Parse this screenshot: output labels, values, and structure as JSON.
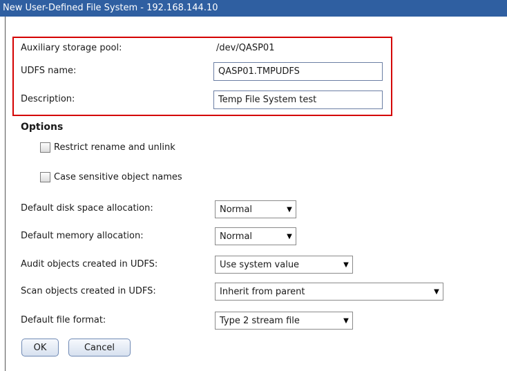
{
  "window": {
    "title": "New User-Defined File System - 192.168.144.10"
  },
  "form": {
    "asp": {
      "label": "Auxiliary storage pool:",
      "value": "/dev/QASP01"
    },
    "udfs_name": {
      "label": "UDFS name:",
      "value": "QASP01.TMPUDFS"
    },
    "description": {
      "label": "Description:",
      "value": "Temp File System test"
    }
  },
  "options": {
    "title": "Options",
    "restrict_rename": {
      "label": "Restrict rename and unlink",
      "checked": false
    },
    "case_sensitive": {
      "label": "Case sensitive object names",
      "checked": false
    }
  },
  "settings": {
    "disk_space": {
      "label": "Default disk space allocation:",
      "value": "Normal"
    },
    "memory": {
      "label": "Default memory allocation:",
      "value": "Normal"
    },
    "audit": {
      "label": "Audit objects created in UDFS:",
      "value": "Use system value"
    },
    "scan": {
      "label": "Scan objects created in UDFS:",
      "value": "Inherit from parent"
    },
    "file_format": {
      "label": "Default file format:",
      "value": "Type 2 stream file"
    }
  },
  "buttons": {
    "ok": "OK",
    "cancel": "Cancel"
  },
  "colors": {
    "titlebar": "#2f5fa1",
    "highlight_border": "#d40000"
  },
  "icons": {
    "dropdown": "chevron-down-icon"
  }
}
